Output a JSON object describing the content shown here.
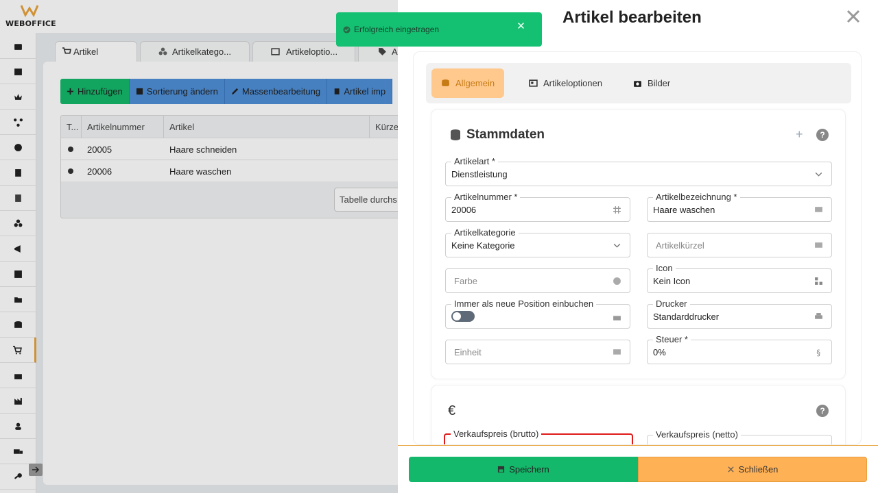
{
  "app": {
    "logo_text": "WEBOFFICE"
  },
  "sidebar": {
    "items": [
      {
        "icon": "cash-register-icon"
      },
      {
        "icon": "calendar-icon"
      },
      {
        "icon": "crown-icon"
      },
      {
        "icon": "network-icon"
      },
      {
        "icon": "clock-icon"
      },
      {
        "icon": "document-icon"
      },
      {
        "icon": "receipt-icon"
      },
      {
        "icon": "boxes-icon"
      },
      {
        "icon": "megaphone-icon"
      },
      {
        "icon": "chart-icon"
      },
      {
        "icon": "folder-icon"
      },
      {
        "icon": "database-icon"
      },
      {
        "icon": "cart-icon"
      },
      {
        "icon": "warehouse-icon"
      },
      {
        "icon": "industry-icon"
      },
      {
        "icon": "users-icon"
      },
      {
        "icon": "truck-icon"
      },
      {
        "icon": "key-icon"
      }
    ]
  },
  "tabs": [
    {
      "label": "Artikel"
    },
    {
      "label": "Artikelkatego..."
    },
    {
      "label": "Artikeloptio..."
    },
    {
      "label": "A"
    }
  ],
  "toolbar": {
    "add": "Hinzufügen",
    "sort": "Sortierung ändern",
    "bulk": "Massenbearbeitung",
    "import": "Artikel imp"
  },
  "table": {
    "headers": [
      "T...",
      "Artikelnummer",
      "Artikel",
      "Kürze"
    ],
    "rows": [
      {
        "number": "20005",
        "name": "Haare schneiden"
      },
      {
        "number": "20006",
        "name": "Haare waschen"
      }
    ],
    "search_button": "Tabelle durchs"
  },
  "toast": {
    "message": "Erfolgreich eingetragen"
  },
  "panel": {
    "title": "Artikel bearbeiten",
    "tabs": {
      "general": "Allgemein",
      "options": "Artikeloptionen",
      "images": "Bilder"
    },
    "stammdaten": {
      "title": "Stammdaten",
      "help": "?",
      "fields": {
        "artikelart": {
          "label": "Artikelart *",
          "value": "Dienstleistung"
        },
        "artikelnummer": {
          "label": "Artikelnummer *",
          "value": "20006"
        },
        "bezeichnung": {
          "label": "Artikelbezeichnung *",
          "value": "Haare waschen"
        },
        "kategorie": {
          "label": "Artikelkategorie",
          "value": "Keine Kategorie"
        },
        "kuerzel": {
          "placeholder": "Artikelkürzel"
        },
        "farbe": {
          "placeholder": "Farbe"
        },
        "icon": {
          "label": "Icon",
          "value": "Kein Icon"
        },
        "neue_position": {
          "label": "Immer als neue Position einbuchen",
          "value": false
        },
        "drucker": {
          "label": "Drucker",
          "value": "Standarddrucker"
        },
        "einheit": {
          "placeholder": "Einheit"
        },
        "steuer": {
          "label": "Steuer *",
          "value": "0%"
        }
      }
    },
    "preise": {
      "symbol": "€",
      "help": "?",
      "fields": {
        "vk_brutto": {
          "label": "Verkaufspreis (brutto)"
        },
        "vk_netto": {
          "label": "Verkaufspreis (netto)"
        }
      }
    },
    "buttons": {
      "save": "Speichern",
      "close": "Schließen"
    }
  },
  "colors": {
    "accent": "#e8a33d",
    "success": "#14b86a",
    "primary": "#4f8fd6",
    "warning": "#ffb156"
  }
}
